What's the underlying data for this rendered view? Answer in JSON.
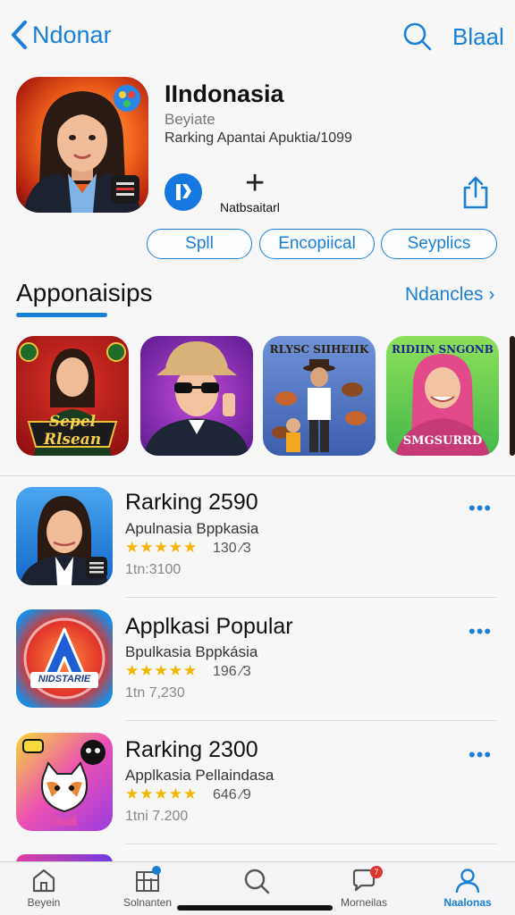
{
  "nav": {
    "back_label": "Ndonar",
    "right_label": "Blaal"
  },
  "app": {
    "title": "IIndonasia",
    "subtitle": "Beyiate",
    "ranking": "Rarking Apantai Apuktia/1099",
    "action_label": "Natbsaitarl"
  },
  "pills": [
    "Spll",
    "Encopiical",
    "Seyplics"
  ],
  "section": {
    "title": "Apponaisips",
    "link": "Ndancles"
  },
  "featured": [
    {
      "caption": "Sepel Rlsean"
    },
    {
      "caption": ""
    },
    {
      "caption": "RLYSC SIIHEIIK"
    },
    {
      "caption": "RIDIIN SNGONB",
      "caption2": "SMGSURRD"
    }
  ],
  "list": [
    {
      "title": "Rarking 2590",
      "subtitle": "Apulnasia Bppkasia",
      "stars": "★★★★★",
      "rating": "130 ⁄3",
      "meta": "1tn:3100"
    },
    {
      "title": "Applkasi Popular",
      "subtitle": "Bpulkasia Bppkásia",
      "stars": "★★★★★",
      "rating": "196 ⁄3",
      "meta": "1tn 7,230",
      "icon_caption": "NIDSTARIE"
    },
    {
      "title": "Rarking 2300",
      "subtitle": "Applkasia Pellaindasa",
      "stars": "★★★★★",
      "rating": "646 ⁄9",
      "meta": "1tni 7.200"
    }
  ],
  "more_glyph": "•••",
  "tabs": [
    {
      "label": "Beyein",
      "icon": "home-icon"
    },
    {
      "label": "Solnanten",
      "icon": "apps-icon",
      "badge": ""
    },
    {
      "label": "",
      "icon": "search-icon"
    },
    {
      "label": "Morneilas",
      "icon": "chat-icon",
      "badge": "7"
    },
    {
      "label": "Naalonas",
      "icon": "person-icon"
    }
  ],
  "colors": {
    "accent": "#1a7fd6",
    "star": "#f5b400",
    "badge_red": "#e0322f"
  }
}
